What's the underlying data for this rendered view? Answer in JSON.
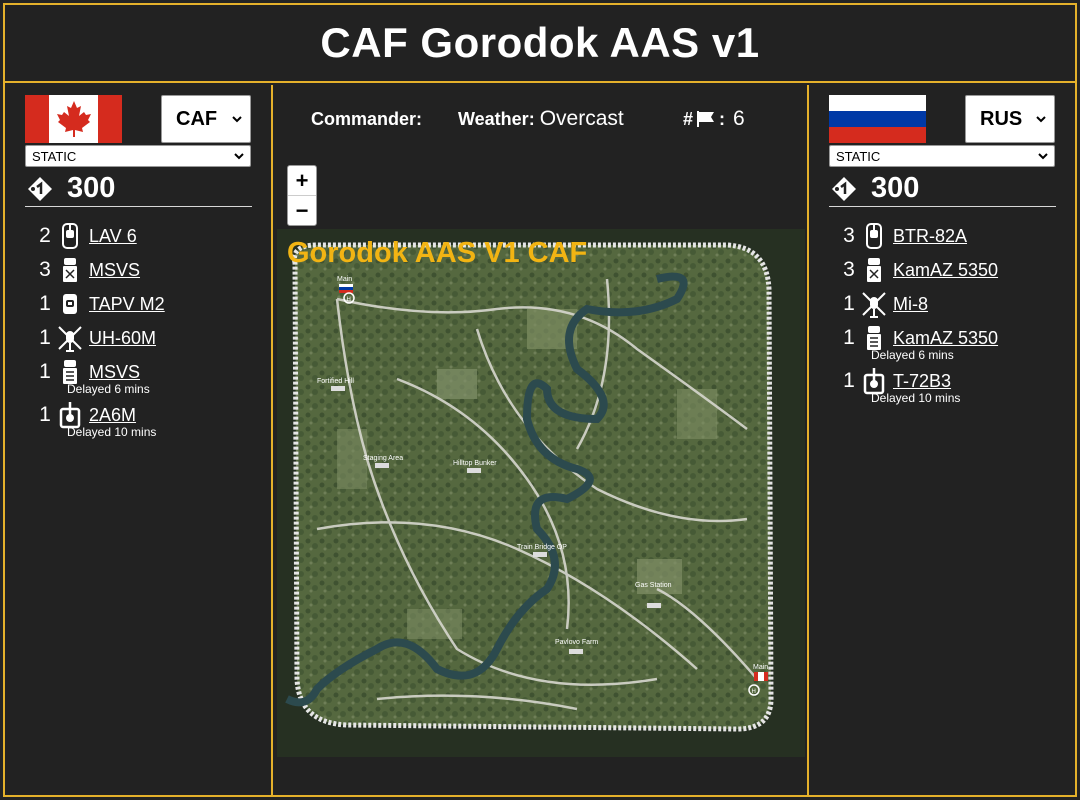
{
  "header": {
    "title": "CAF Gorodok AAS v1"
  },
  "left_team": {
    "faction": "CAF",
    "mode": "STATIC",
    "tickets": "300",
    "vehicles": [
      {
        "count": "2",
        "name": "LAV 6",
        "icon": "ifv-icon",
        "delay": ""
      },
      {
        "count": "3",
        "name": "MSVS",
        "icon": "logistics-truck-icon",
        "delay": ""
      },
      {
        "count": "1",
        "name": "TAPV M2",
        "icon": "mrap-icon",
        "delay": ""
      },
      {
        "count": "1",
        "name": "UH-60M",
        "icon": "helicopter-icon",
        "delay": ""
      },
      {
        "count": "1",
        "name": "MSVS",
        "icon": "transport-truck-icon",
        "delay": "Delayed 6 mins"
      },
      {
        "count": "1",
        "name": "2A6M",
        "icon": "tank-icon",
        "delay": "Delayed 10 mins"
      }
    ]
  },
  "right_team": {
    "faction": "RUS",
    "mode": "STATIC",
    "tickets": "300",
    "vehicles": [
      {
        "count": "3",
        "name": "BTR-82A",
        "icon": "ifv-icon",
        "delay": ""
      },
      {
        "count": "3",
        "name": "KamAZ 5350",
        "icon": "logistics-truck-icon",
        "delay": ""
      },
      {
        "count": "1",
        "name": "Mi-8",
        "icon": "helicopter-icon",
        "delay": ""
      },
      {
        "count": "1",
        "name": "KamAZ 5350",
        "icon": "transport-truck-icon",
        "delay": "Delayed 6 mins"
      },
      {
        "count": "1",
        "name": "T-72B3",
        "icon": "tank-icon",
        "delay": "Delayed 10 mins"
      }
    ]
  },
  "info": {
    "commander_label": "Commander:",
    "commander_value": "",
    "weather_label": "Weather:",
    "weather_value": "Overcast",
    "flags_prefix": "#",
    "flags_sep": ":",
    "flags_count": "6"
  },
  "map": {
    "title": "Gorodok AAS V1 CAF",
    "zoom_in": "+",
    "zoom_out": "−",
    "labels": {
      "main_top": "Main",
      "fortified_hill": "Fortified Hill",
      "staging_area": "Staging Area",
      "hilltop_bunker": "Hilltop Bunker",
      "train_bridge_op": "Train Bridge OP",
      "gas_station": "Gas Station",
      "pavlovo_farm": "Pavlovo Farm",
      "main_bottom": "Main"
    }
  },
  "colors": {
    "accent": "#e5b12b",
    "map_title": "#f2b413",
    "background": "#222222",
    "canada_red": "#d52b1e",
    "russia_white": "#ffffff",
    "russia_blue": "#0039a6",
    "russia_red": "#d52b1e"
  }
}
